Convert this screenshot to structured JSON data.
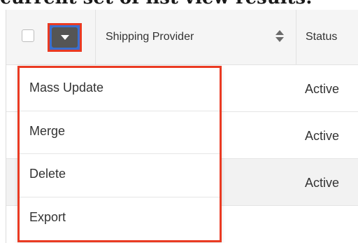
{
  "heading": {
    "text": "current set of list view results:"
  },
  "table": {
    "columns": [
      {
        "label": "Shipping Provider"
      },
      {
        "label": "Status"
      }
    ],
    "rows": [
      {
        "status": "Active"
      },
      {
        "status": "Active"
      },
      {
        "status": "Active"
      }
    ]
  },
  "actions_menu": {
    "items": [
      {
        "label": "Mass Update"
      },
      {
        "label": "Merge"
      },
      {
        "label": "Delete"
      },
      {
        "label": "Export"
      }
    ]
  },
  "colors": {
    "highlight": "#ea3a22",
    "focus": "#3a6fd0",
    "button": "#555555"
  },
  "icons": [
    "checkbox-icon",
    "caret-down-icon",
    "sort-icon"
  ]
}
